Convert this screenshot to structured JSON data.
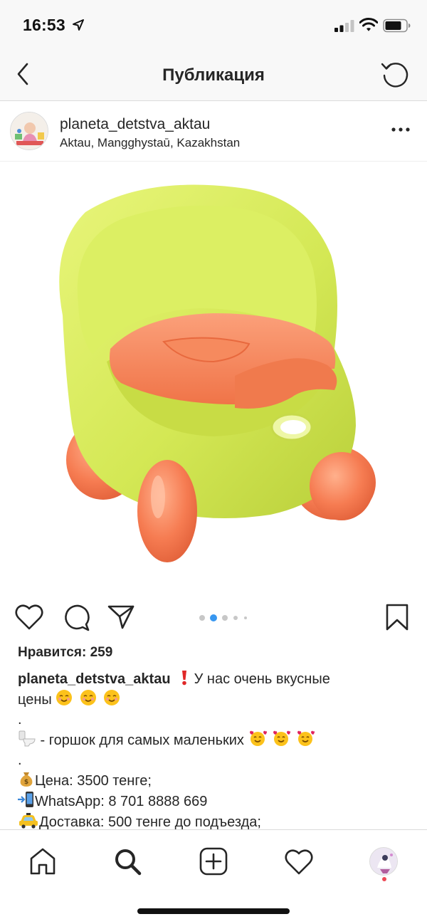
{
  "status_bar": {
    "time": "16:53",
    "icons": [
      "location-arrow-icon",
      "cellular-signal-icon",
      "wifi-icon",
      "battery-icon"
    ]
  },
  "nav": {
    "title": "Публикация",
    "back_icon": "chevron-left-icon",
    "refresh_icon": "refresh-icon"
  },
  "post": {
    "username": "planeta_detstva_aktau",
    "location": "Aktau, Mangghystaū, Kazakhstan",
    "more_icon": "more-horizontal-icon",
    "image_alt_icons": [
      "potty-chair-image"
    ],
    "carousel": {
      "count": 5,
      "active": 1
    },
    "likes_label": "Нравится: 259"
  },
  "caption": {
    "username": "planeta_detstva_aktau",
    "line1_text": " У нас очень вкусные",
    "line1b_text": "цены ",
    "dot1": ".",
    "line2_text": " - горшок для самых маленьких ",
    "dot2": ".",
    "price_text": "Цена: 3500 тенге;",
    "whatsapp_text": "WhatsApp: 8 701 8888 669",
    "delivery_text": "Доставка: 500 тенге до подъезда;"
  },
  "tab_bar": {
    "tabs": [
      "home-icon",
      "search-icon",
      "new-post-icon",
      "activity-heart-icon",
      "profile-avatar"
    ]
  },
  "colors": {
    "potty_body": "#d9ec5a",
    "potty_accent": "#f78a5f",
    "notification_dot": "#ed4956",
    "carousel_active": "#3897f0"
  }
}
